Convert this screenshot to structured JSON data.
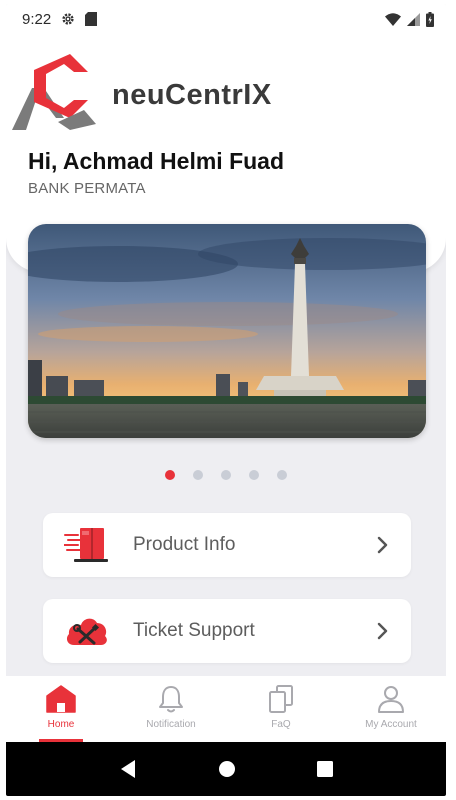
{
  "status_bar": {
    "time": "9:22",
    "icons": [
      "settings-gear-icon",
      "sd-card-icon",
      "wifi-icon",
      "cell-signal-icon",
      "battery-icon"
    ]
  },
  "header": {
    "logo_text": "neuCentrIX",
    "greeting": "Hi, Achmad Helmi Fuad",
    "company": "BANK PERMATA"
  },
  "banner": {
    "image": "monument-skyline-sunset",
    "slide_count": 5,
    "active_slide": 1
  },
  "menu": [
    {
      "label": "Product Info",
      "icon": "product-box-icon"
    },
    {
      "label": "Ticket Support",
      "icon": "cloud-tools-icon"
    }
  ],
  "bottom_nav": [
    {
      "label": "Home",
      "icon": "home-icon",
      "active": true
    },
    {
      "label": "Notification",
      "icon": "bell-icon",
      "active": false
    },
    {
      "label": "FaQ",
      "icon": "copy-icon",
      "active": false
    },
    {
      "label": "My Account",
      "icon": "user-icon",
      "active": false
    }
  ],
  "colors": {
    "accent": "#e8323a",
    "inactive": "#a9a9ae",
    "background": "#eeeef2",
    "logo_gray": "#3a3a3a"
  }
}
